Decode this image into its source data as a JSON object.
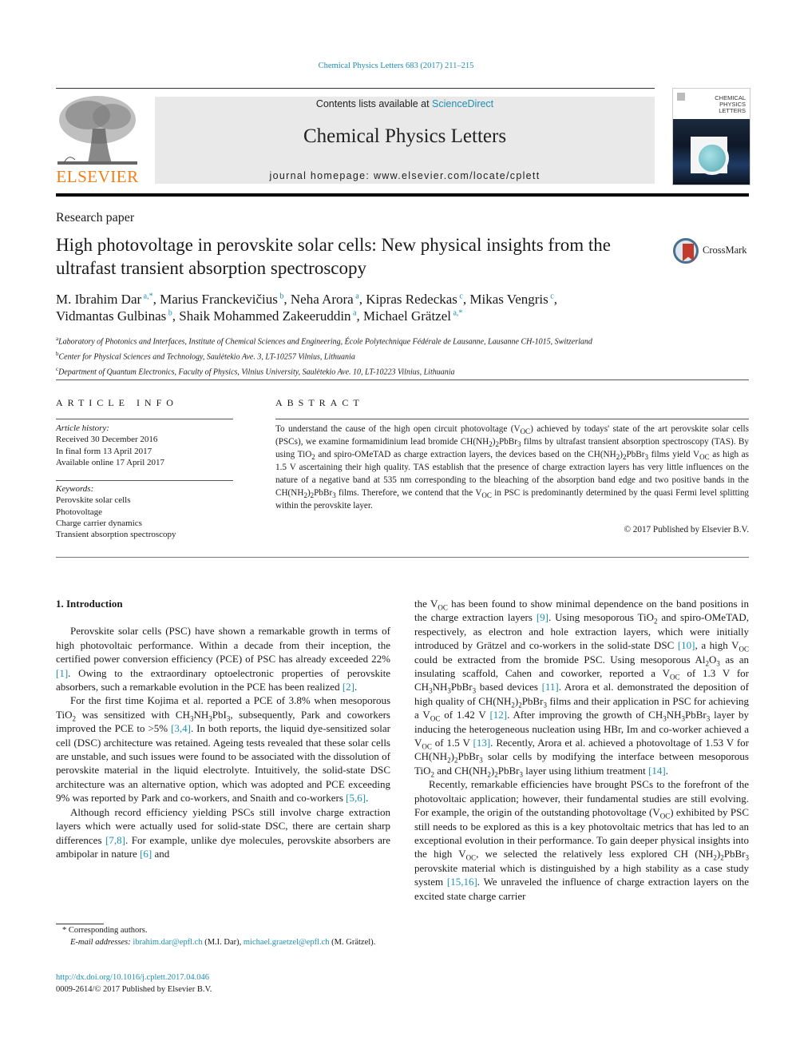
{
  "header": {
    "journal_ref": "Chemical Physics Letters 683 (2017) 211–215",
    "contents_prefix": "Contents lists available at ",
    "contents_link": "ScienceDirect",
    "journal_title": "Chemical Physics Letters",
    "homepage": "journal homepage: www.elsevier.com/locate/cplett",
    "publisher_logo": "ELSEVIER",
    "cover_title": [
      "CHEMICAL",
      "PHYSICS",
      "LETTERS"
    ],
    "crossmark_label": "CrossMark"
  },
  "article": {
    "type": "Research paper",
    "title": "High photovoltage in perovskite solar cells: New physical insights from the ultrafast transient absorption spectroscopy",
    "authors": [
      {
        "name": "M. Ibrahim Dar",
        "aff": "a,*"
      },
      {
        "name": "Marius Franckevičius",
        "aff": "b"
      },
      {
        "name": "Neha Arora",
        "aff": "a"
      },
      {
        "name": "Kipras Redeckas",
        "aff": "c"
      },
      {
        "name": "Mikas Vengris",
        "aff": "c"
      },
      {
        "name": "Vidmantas Gulbinas",
        "aff": "b"
      },
      {
        "name": "Shaik Mohammed Zakeeruddin",
        "aff": "a"
      },
      {
        "name": "Michael Grätzel",
        "aff": "a,*"
      }
    ],
    "affiliations": [
      {
        "key": "a",
        "text": "Laboratory of Photonics and Interfaces, Institute of Chemical Sciences and Engineering, École Polytechnique Fédérale de Lausanne, Lausanne CH-1015, Switzerland"
      },
      {
        "key": "b",
        "text": "Center for Physical Sciences and Technology, Saulėtekio Ave. 3, LT-10257 Vilnius, Lithuania"
      },
      {
        "key": "c",
        "text": "Department of Quantum Electronics, Faculty of Physics, Vilnius University, Saulėtekio Ave. 10, LT-10223 Vilnius, Lithuania"
      }
    ]
  },
  "article_info": {
    "heading": "ARTICLE INFO",
    "history_label": "Article history:",
    "history": [
      "Received 30 December 2016",
      "In final form 13 April 2017",
      "Available online 17 April 2017"
    ],
    "keywords_label": "Keywords:",
    "keywords": [
      "Perovskite solar cells",
      "Photovoltage",
      "Charge carrier dynamics",
      "Transient absorption spectroscopy"
    ]
  },
  "abstract": {
    "heading": "ABSTRACT",
    "s1": "To understand the cause of the high open circuit photovoltage (V",
    "s2": ") achieved by todays' state of the art perovskite solar cells (PSCs), we examine formamidinium lead bromide CH(NH",
    "s3": "PbBr",
    "s4": " films by ultrafast transient absorption spectroscopy (TAS). By using TiO",
    "s5": " and spiro-OMeTAD as charge extraction layers, the devices based on the CH(NH",
    "s6": " films yield V",
    "s7": " as high as 1.5 V ascertaining their high quality. TAS establish that the presence of charge extraction layers has very little influences on the nature of a negative band at 535 nm corresponding to the bleaching of the absorption band edge and two positive bands in the CH(NH",
    "s8": " films. Therefore, we contend that the V",
    "s9": " in PSC is predominantly determined by the quasi Fermi level splitting within the perovskite layer.",
    "copyright": "© 2017 Published by Elsevier B.V."
  },
  "body": {
    "section_heading": "1. Introduction",
    "left": {
      "p1a": "Perovskite solar cells (PSC) have shown a remarkable growth in terms of high photovoltaic performance. Within a decade from their inception, the certified power conversion efficiency (PCE) of PSC has already exceeded 22% ",
      "p1c1": "[1]",
      "p1b": ". Owing to the extraordinary optoelectronic properties of perovskite absorbers, such a remarkable evolution in the PCE has been realized ",
      "p1c2": "[2]",
      "p2a": "For the first time Kojima et al. reported a PCE of 3.8% when mesoporous TiO",
      "p2b": " was sensitized with CH",
      "p2c": "NH",
      "p2d": "PbI",
      "p2e": ", subsequently, Park and coworkers improved the PCE to >5% ",
      "p2c1": "[3,4]",
      "p2f": ". In both reports, the liquid dye-sensitized solar cell (DSC) architecture was retained. Ageing tests revealed that these solar cells are unstable, and such issues were found to be associated with the dissolution of perovskite material in the liquid electrolyte. Intuitively, the solid-state DSC architecture was an alternative option, which was adopted and PCE exceeding 9% was reported by Park and co-workers, and Snaith and co-workers ",
      "p2c2": "[5,6]",
      "p3a": "Although record efficiency yielding PSCs still involve charge extraction layers which were actually used for solid-state DSC, there are certain sharp differences ",
      "p3c1": "[7,8]",
      "p3b": ". For example, unlike dye molecules, perovskite absorbers are ambipolar in nature ",
      "p3c2": "[6]",
      "p3c": " and"
    },
    "right": {
      "p1a": "the V",
      "p1b": " has been found to show minimal dependence on the band positions in the charge extraction layers ",
      "c9": "[9]",
      "p1c": ". Using mesoporous TiO",
      "p1d": " and spiro-OMeTAD, respectively, as electron and hole extraction layers, which were initially introduced by Grätzel and co-workers in the solid-state DSC ",
      "c10": "[10]",
      "p1e": ", a high V",
      "p1f": " could be extracted from the bromide PSC. Using mesoporous Al",
      "p1g": "O",
      "p1h": " as an insulating scaffold, Cahen and coworker, reported a V",
      "p1i": " of 1.3 V for CH",
      "p1j": " based devices ",
      "c11": "[11]",
      "p1k": ". Arora et al. demonstrated the deposition of high quality of CH(NH",
      "p1l": " films and their application in PSC for achieving a V",
      "p1m": " of 1.42 V ",
      "c12": "[12]",
      "p1n": ". After improving the growth of CH",
      "p1o": " layer by inducing the heterogeneous nucleation using HBr, Im and co-worker achieved a V",
      "p1p": " of 1.5 V ",
      "c13": "[13]",
      "p1q": ". Recently, Arora et al. achieved a photovoltage of 1.53 V for CH(NH",
      "p1r": " solar cells by modifying the interface between mesoporous TiO",
      "p1s": " and CH(NH",
      "p1t": " layer using lithium treatment ",
      "c14": "[14]",
      "p2a": "Recently, remarkable efficiencies have brought PSCs to the forefront of the photovoltaic application; however, their fundamental studies are still evolving. For example, the origin of the outstanding photovoltage (V",
      "p2b": ") exhibited by PSC still needs to be explored as this is a key photovoltaic metrics that has led to an exceptional evolution in their performance. To gain deeper physical insights into the high V",
      "p2c": ", we selected the relatively less explored CH (NH",
      "p2d": " perovskite material which is distinguished by a high stability as a case study system ",
      "c1516": "[15,16]",
      "p2e": ". We unraveled the influence of charge extraction layers on the excited state charge carrier"
    },
    "sub": {
      "oc": "OC",
      "two": "2",
      "three": "3",
      "PbBr3": "PbBr",
      "CH3NH3PbBr3": "NH"
    }
  },
  "footnotes": {
    "corresponding": "* Corresponding authors.",
    "email_label": "E-mail addresses:",
    "email1": "ibrahim.dar@epfl.ch",
    "email1_who": " (M.I. Dar), ",
    "email2": "michael.graetzel@epfl.ch",
    "email2_who": " (M. Grätzel).",
    "doi": "http://dx.doi.org/10.1016/j.cplett.2017.04.046",
    "issn": "0009-2614/© 2017 Published by Elsevier B.V."
  },
  "colors": {
    "link": "#1f8fb3",
    "elsevier_orange": "#f07f1a",
    "masthead_bg": "#e9e9e9"
  }
}
